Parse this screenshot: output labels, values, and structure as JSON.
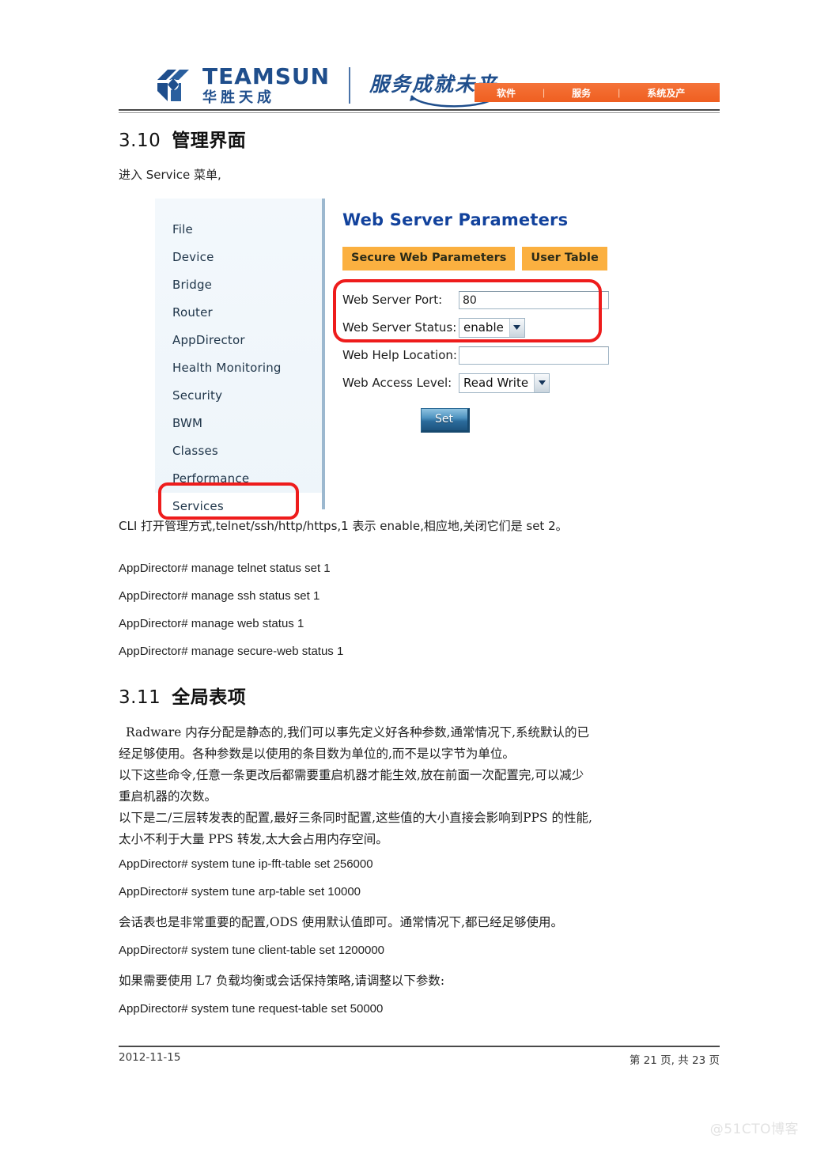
{
  "header": {
    "logo": {
      "icon": "teamsun-logo-icon",
      "english": "TEAMSUN",
      "chinese": "华胜天成",
      "slogan": "服务成就未来"
    },
    "nav": {
      "items": [
        "软件",
        "服务",
        "系统及产"
      ],
      "separator": "|",
      "bar_color": "#f2692c"
    }
  },
  "doc": {
    "section_310": {
      "number": "3.10",
      "title": "管理界面",
      "intro": "进入 Service 菜单,"
    },
    "screenshot": {
      "sidebar": {
        "items": [
          {
            "label": "File"
          },
          {
            "label": "Device"
          },
          {
            "label": "Bridge"
          },
          {
            "label": "Router"
          },
          {
            "label": "AppDirector"
          },
          {
            "label": "Health Monitoring"
          },
          {
            "label": "Security"
          },
          {
            "label": "BWM"
          },
          {
            "label": "Classes"
          },
          {
            "label": "Performance"
          },
          {
            "label": "Services"
          }
        ],
        "selected": "Services",
        "highlight_color": "#ee1c1c"
      },
      "panel": {
        "title": "Web Server Parameters",
        "title_color": "#12429c",
        "tabs": [
          {
            "label": "Secure Web Parameters"
          },
          {
            "label": "User Table"
          }
        ],
        "tab_color": "#fbb040",
        "fields": {
          "port_label": "Web Server Port:",
          "port_value": "80",
          "status_label": "Web Server Status:",
          "status_value": "enable",
          "help_label": "Web Help Location:",
          "help_value": "",
          "access_label": "Web Access Level:",
          "access_value": "Read Write"
        },
        "set_button": "Set"
      }
    },
    "cli_note": "CLI 打开管理方式,telnet/ssh/http/https,1 表示 enable,相应地,关闭它们是 set 2。",
    "manage_commands": [
      "AppDirector# manage telnet status set 1",
      "AppDirector# manage ssh status set 1",
      "AppDirector# manage web status 1",
      "AppDirector# manage secure-web status 1"
    ],
    "section_311": {
      "number": "3.11",
      "title": "全局表项",
      "paragraphs": [
        "Radware 内存分配是静态的,我们可以事先定义好各种参数,通常情况下,系统默认的已",
        "经足够使用。各种参数是以使用的条目数为单位的,而不是以字节为单位。",
        "以下这些命令,任意一条更改后都需要重启机器才能生效,放在前面一次配置完,可以减少",
        "重启机器的次数。",
        "以下是二/三层转发表的配置,最好三条同时配置,这些值的大小直接会影响到PPS 的性能,",
        "太小不利于大量 PPS 转发,太大会占用内存空间。"
      ],
      "lines": [
        {
          "type": "cmd",
          "text": "AppDirector# system tune ip-fft-table set 256000"
        },
        {
          "type": "cmd",
          "text": "AppDirector# system tune arp-table set 10000"
        },
        {
          "type": "para",
          "text": "会话表也是非常重要的配置,ODS 使用默认值即可。通常情况下,都已经足够使用。"
        },
        {
          "type": "cmd",
          "text": "AppDirector# system tune client-table set 1200000"
        },
        {
          "type": "para",
          "text": "如果需要使用 L7 负载均衡或会话保持策略,请调整以下参数:"
        },
        {
          "type": "cmd",
          "text": "AppDirector# system tune request-table set 50000"
        }
      ]
    }
  },
  "footer": {
    "date": "2012-11-15",
    "page_info": "第 21 页, 共 23 页"
  },
  "watermark": "@51CTO博客"
}
